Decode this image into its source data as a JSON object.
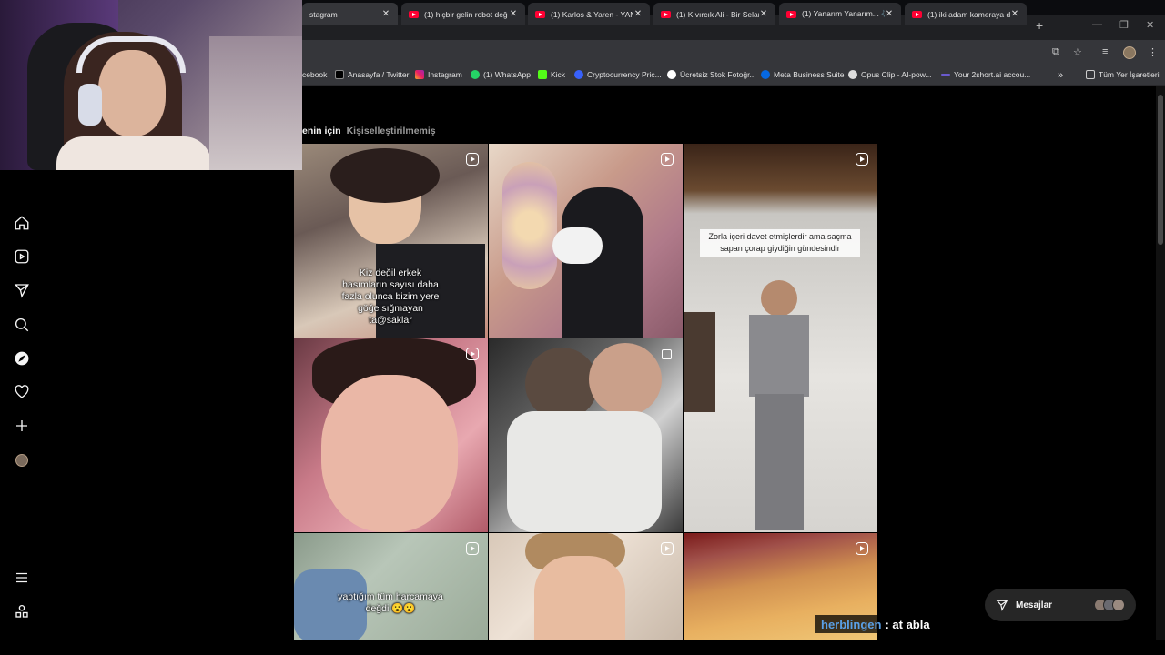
{
  "browser": {
    "tabs": [
      {
        "label": "stagram",
        "active": true
      },
      {
        "label": "(1) hiçbir gelin robot değ"
      },
      {
        "label": "(1) Karlos & Yaren - YANA"
      },
      {
        "label": "(1) Kıvırcık Ali - Bir Selam"
      },
      {
        "label": "(1) Yanarım Yanarım... 🎶"
      },
      {
        "label": "(1) iki adam kameraya de"
      }
    ],
    "bookmarks": [
      {
        "label": "cebook"
      },
      {
        "label": "Anasayfa / Twitter"
      },
      {
        "label": "Instagram"
      },
      {
        "label": "(1) WhatsApp"
      },
      {
        "label": "Kick"
      },
      {
        "label": "Cryptocurrency Pric..."
      },
      {
        "label": "Ücretsiz Stok Fotoğr..."
      },
      {
        "label": "Meta Business Suite"
      },
      {
        "label": "Opus Clip - AI-pow..."
      },
      {
        "label": "Your 2short.ai accou..."
      },
      {
        "label": "»"
      },
      {
        "label": "Tüm Yer İşaretleri"
      }
    ]
  },
  "feed": {
    "tabs": {
      "for_you": "enin için",
      "not_personalized": "Kişiselleştirilmemiş"
    },
    "captions": {
      "tile1": "Kiz değil erkek hasımların sayısı daha fazla olunca bizim yere göğe sığmayan ta@saklar",
      "tile3": "Zorla içeri davet etmişlerdir ama saçma sapan çorap giydiğin gündesindir",
      "tile7": "yaptığım tüm harcamaya değdi 😮😮"
    }
  },
  "messages": {
    "label": "Mesajlar"
  },
  "chat": {
    "user": "herblingen",
    "text": ": at abla"
  },
  "icons": [
    "home-icon",
    "reels-icon",
    "send-icon",
    "search-icon",
    "explore-icon",
    "heart-icon",
    "plus-icon",
    "profile-icon",
    "menu-icon",
    "apps-icon"
  ]
}
